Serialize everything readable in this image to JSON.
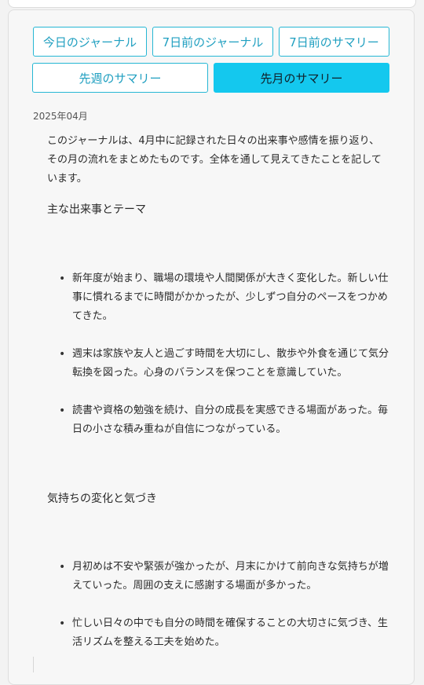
{
  "tabs": [
    {
      "label": "今日のジャーナル",
      "active": false
    },
    {
      "label": "7日前のジャーナル",
      "active": false
    },
    {
      "label": "7日前のサマリー",
      "active": false
    },
    {
      "label": "先週のサマリー",
      "active": false
    },
    {
      "label": "先月のサマリー",
      "active": true
    }
  ],
  "summary": {
    "date": "2025年04月",
    "intro": "このジャーナルは、4月中に記録された日々の出来事や感情を振り返り、その月の流れをまとめたものです。全体を通して見えてきたことを記しています。",
    "section1_heading": "主な出来事とテーマ",
    "section1_items": [
      "新年度が始まり、職場の環境や人間関係が大きく変化した。新しい仕事に慣れるまでに時間がかかったが、少しずつ自分のペースをつかめてきた。",
      "週末は家族や友人と過ごす時間を大切にし、散歩や外食を通じて気分転換を図った。心身のバランスを保つことを意識していた。",
      "読書や資格の勉強を続け、自分の成長を実感できる場面があった。毎日の小さな積み重ねが自信につながっている。"
    ],
    "section2_heading": "気持ちの変化と気づき",
    "section2_items": [
      "月初めは不安や緊張が強かったが、月末にかけて前向きな気持ちが増えていった。周囲の支えに感謝する場面が多かった。",
      "忙しい日々の中でも自分の時間を確保することの大切さに気づき、生活リズムを整える工夫を始めた。"
    ]
  }
}
